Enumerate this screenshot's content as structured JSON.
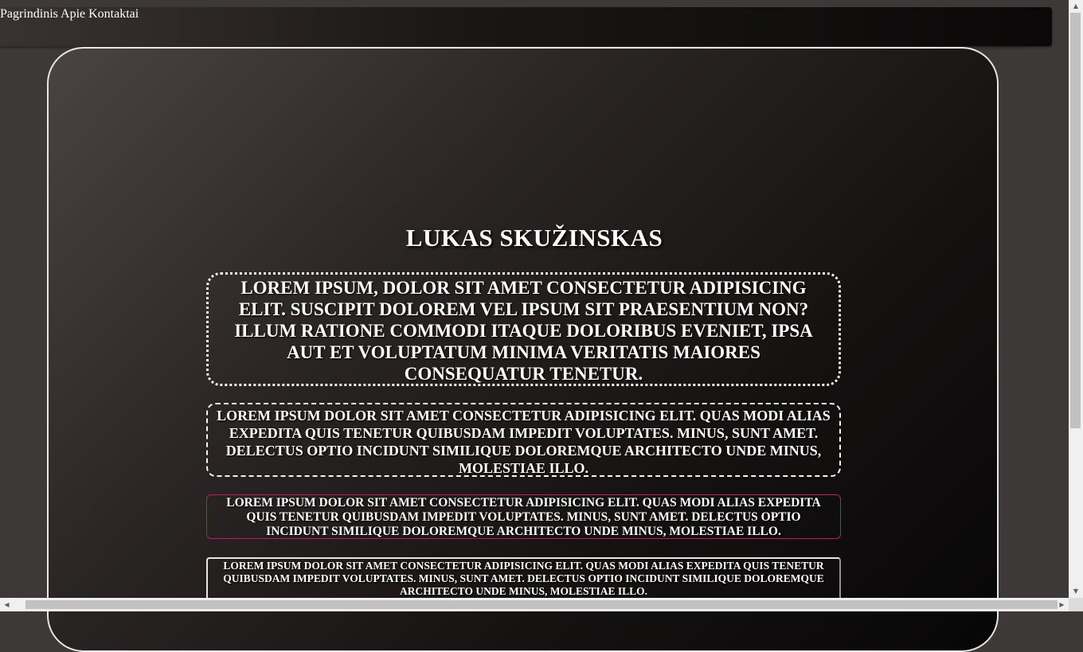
{
  "nav": {
    "items": [
      {
        "label": "Pagrindinis"
      },
      {
        "label": "Apie"
      },
      {
        "label": "Kontaktai"
      }
    ]
  },
  "header": {
    "title": "LUKAS SKUŽINSKAS"
  },
  "boxes": [
    {
      "text": "LOREM IPSUM, DOLOR SIT AMET CONSECTETUR ADIPISICING ELIT. SUSCIPIT DOLOREM VEL IPSUM SIT PRAESENTIUM NON? ILLUM RATIONE COMMODI ITAQUE DOLORIBUS EVENIET, IPSA AUT ET VOLUPTATUM MINIMA VERITATIS MAIORES CONSEQUATUR TENETUR."
    },
    {
      "text": "LOREM IPSUM DOLOR SIT AMET CONSECTETUR ADIPISICING ELIT. QUAS MODI ALIAS EXPEDITA QUIS TENETUR QUIBUSDAM IMPEDIT VOLUPTATES. MINUS, SUNT AMET. DELECTUS OPTIO INCIDUNT SIMILIQUE DOLOREMQUE ARCHITECTO UNDE MINUS, MOLESTIAE ILLO."
    },
    {
      "text": "LOREM IPSUM DOLOR SIT AMET CONSECTETUR ADIPISICING ELIT. QUAS MODI ALIAS EXPEDITA QUIS TENETUR QUIBUSDAM IMPEDIT VOLUPTATES. MINUS, SUNT AMET. DELECTUS OPTIO INCIDUNT SIMILIQUE DOLOREMQUE ARCHITECTO UNDE MINUS, MOLESTIAE ILLO."
    },
    {
      "text": "LOREM IPSUM DOLOR SIT AMET CONSECTETUR ADIPISICING ELIT. QUAS MODI ALIAS EXPEDITA QUIS TENETUR QUIBUSDAM IMPEDIT VOLUPTATES. MINUS, SUNT AMET. DELECTUS OPTIO INCIDUNT SIMILIQUE DOLOREMQUE ARCHITECTO UNDE MINUS, MOLESTIAE ILLO."
    }
  ],
  "colors": {
    "page_bg": "#3d3938",
    "text": "#ffffff",
    "accent_border": "#c2186b"
  },
  "icons": {
    "scroll_up": "triangle-up-icon",
    "scroll_down": "triangle-down-icon",
    "scroll_left": "triangle-left-icon",
    "scroll_right": "triangle-right-icon"
  }
}
